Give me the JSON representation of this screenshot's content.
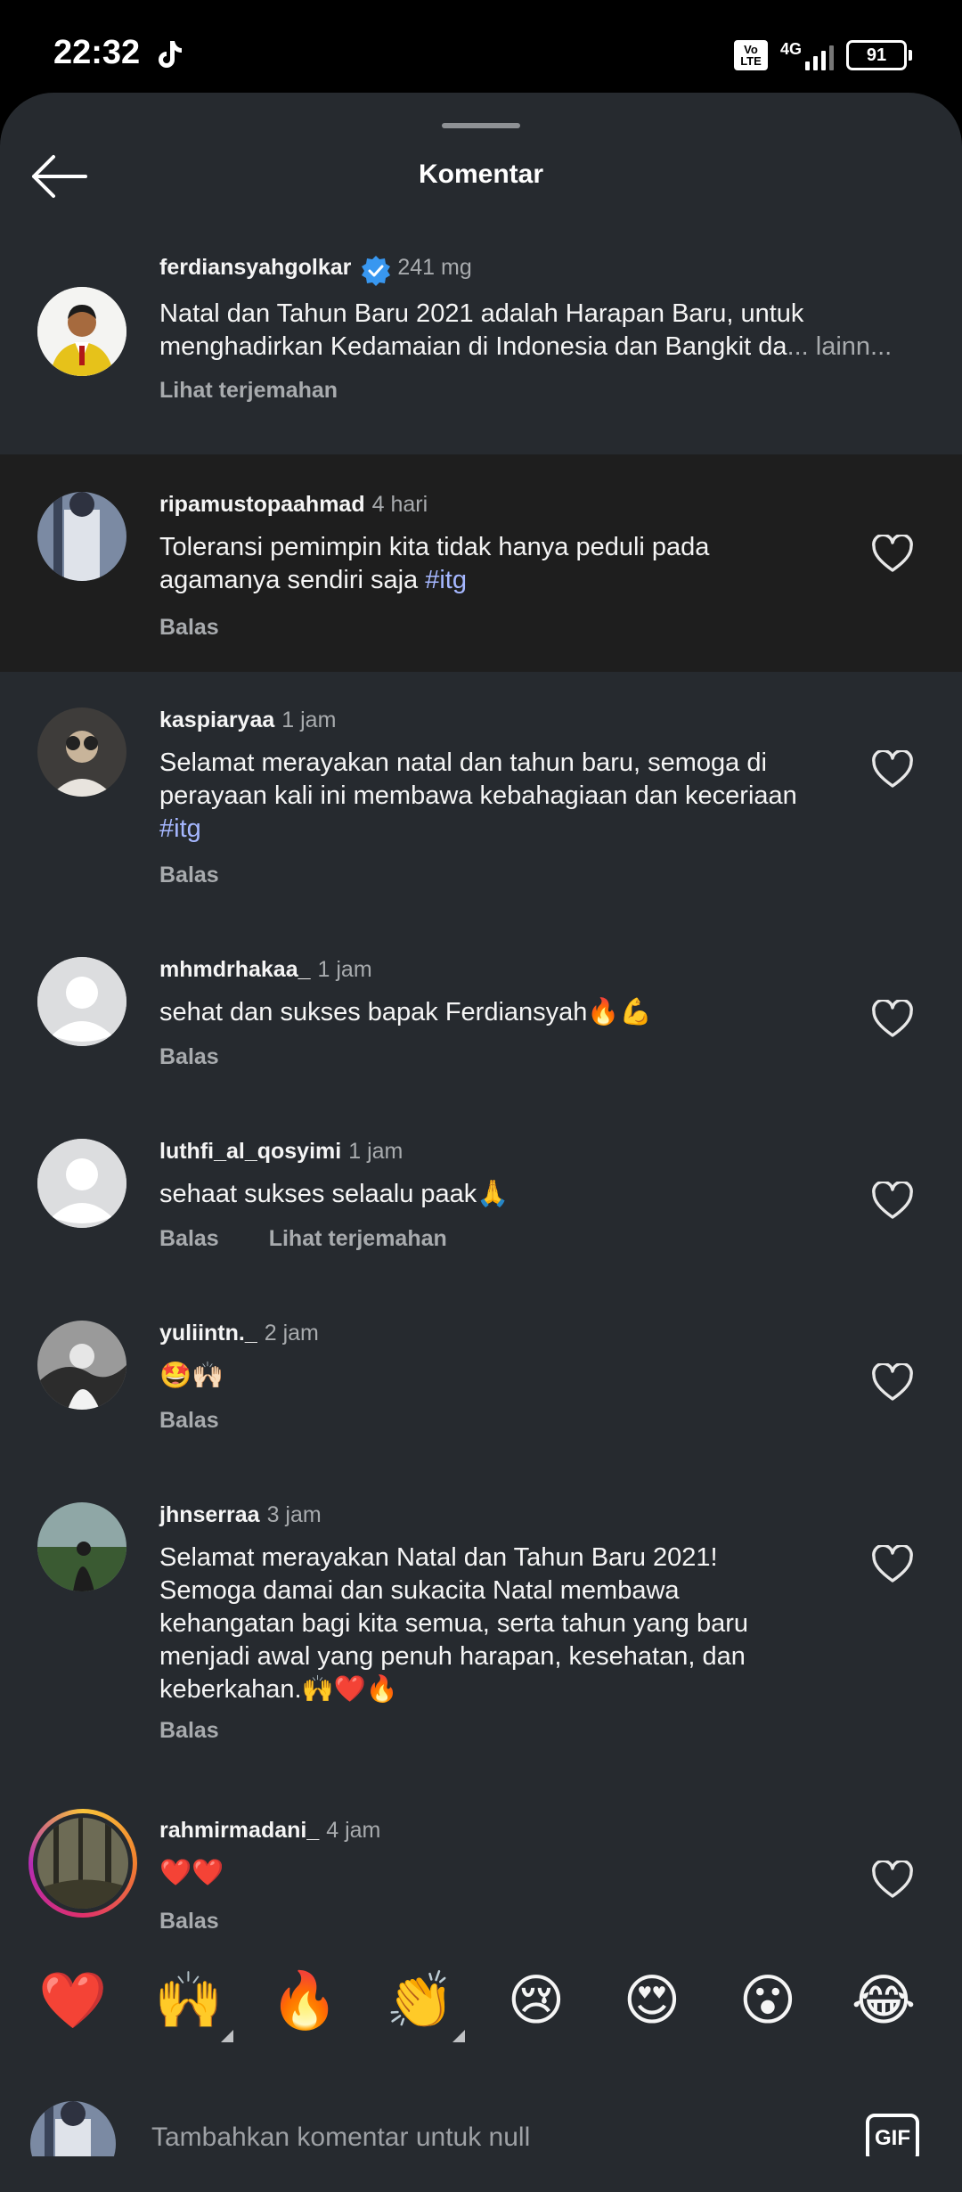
{
  "status_bar": {
    "time": "22:32",
    "network": "4G",
    "volte": "Vo LTE",
    "battery": "91"
  },
  "header": {
    "title": "Komentar"
  },
  "caption": {
    "username": "ferdiansyahgolkar",
    "time": "241 mg",
    "text": "Natal dan Tahun Baru 2021 adalah Harapan Baru, untuk menghadirkan Kedamaian di Indonesia dan Bangkit da",
    "more": "... lainn...",
    "translate": "Lihat terjemahan"
  },
  "comments": [
    {
      "username": "ripamustopaahmad",
      "time": "4 hari",
      "text": "Toleransi pemimpin kita tidak hanya peduli pada agamanya sendiri saja ",
      "tag": "#itg",
      "reply": "Balas"
    },
    {
      "username": "kaspiaryaa",
      "time": "1 jam",
      "text": "Selamat merayakan natal dan tahun baru, semoga di perayaan kali ini membawa kebahagiaan dan keceriaan ",
      "tag": "#itg",
      "reply": "Balas"
    },
    {
      "username": "mhmdrhakaa_",
      "time": "1 jam",
      "text": "sehat dan sukses bapak Ferdiansyah🔥💪",
      "reply": "Balas"
    },
    {
      "username": "luthfi_al_qosyimi",
      "time": "1 jam",
      "text": "sehaat sukses selaalu paak🙏",
      "reply": "Balas",
      "translate": "Lihat terjemahan"
    },
    {
      "username": "yuliintn._",
      "time": "2 jam",
      "text": "🤩🙌🏻",
      "reply": "Balas"
    },
    {
      "username": "jhnserraa",
      "time": "3 jam",
      "text": "Selamat merayakan Natal dan Tahun Baru 2021! Semoga damai dan sukacita Natal membawa kehangatan bagi kita semua, serta tahun yang baru menjadi awal yang penuh harapan, kesehatan, dan keberkahan.🙌❤️🔥",
      "reply": "Balas"
    },
    {
      "username": "rahmirmadani_",
      "time": "4 jam",
      "text": "❤️❤️",
      "reply": "Balas"
    }
  ],
  "emoji_bar": [
    "❤️",
    "🙌",
    "🔥",
    "👏",
    "😢",
    "😍",
    "😮",
    "😂"
  ],
  "composer": {
    "placeholder": "Tambahkan komentar untuk null",
    "gif_label": "GIF"
  }
}
